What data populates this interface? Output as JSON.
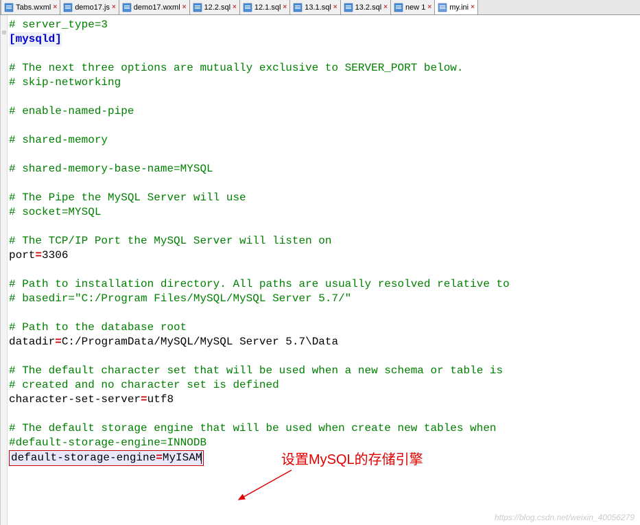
{
  "tabs": [
    {
      "label": "Tabs.wxml",
      "icon": "file-xml"
    },
    {
      "label": "demo17.js",
      "icon": "file-js"
    },
    {
      "label": "demo17.wxml",
      "icon": "file-xml"
    },
    {
      "label": "12.2.sql",
      "icon": "file-sql"
    },
    {
      "label": "12.1.sql",
      "icon": "file-sql"
    },
    {
      "label": "13.1.sql",
      "icon": "file-sql"
    },
    {
      "label": "13.2.sql",
      "icon": "file-sql"
    },
    {
      "label": "new 1",
      "icon": "file-txt"
    },
    {
      "label": "my.ini",
      "icon": "file-ini",
      "active": true
    }
  ],
  "code_lines": [
    {
      "type": "comment",
      "text": "# server_type=3"
    },
    {
      "type": "section",
      "text": "[mysqld]"
    },
    {
      "type": "blank",
      "text": ""
    },
    {
      "type": "comment",
      "text": "# The next three options are mutually exclusive to SERVER_PORT below."
    },
    {
      "type": "comment",
      "text": "# skip-networking"
    },
    {
      "type": "blank",
      "text": ""
    },
    {
      "type": "comment",
      "text": "# enable-named-pipe"
    },
    {
      "type": "blank",
      "text": ""
    },
    {
      "type": "comment",
      "text": "# shared-memory"
    },
    {
      "type": "blank",
      "text": ""
    },
    {
      "type": "comment",
      "text": "# shared-memory-base-name=MYSQL"
    },
    {
      "type": "blank",
      "text": ""
    },
    {
      "type": "comment",
      "text": "# The Pipe the MySQL Server will use"
    },
    {
      "type": "comment",
      "text": "# socket=MYSQL"
    },
    {
      "type": "blank",
      "text": ""
    },
    {
      "type": "comment",
      "text": "# The TCP/IP Port the MySQL Server will listen on"
    },
    {
      "type": "kv",
      "key": "port",
      "val": "3306"
    },
    {
      "type": "blank",
      "text": ""
    },
    {
      "type": "comment",
      "text": "# Path to installation directory. All paths are usually resolved relative to"
    },
    {
      "type": "comment",
      "text": "# basedir=\"C:/Program Files/MySQL/MySQL Server 5.7/\""
    },
    {
      "type": "blank",
      "text": ""
    },
    {
      "type": "comment",
      "text": "# Path to the database root"
    },
    {
      "type": "kv",
      "key": "datadir",
      "val": "C:/ProgramData/MySQL/MySQL Server 5.7\\Data"
    },
    {
      "type": "blank",
      "text": ""
    },
    {
      "type": "comment",
      "text": "# The default character set that will be used when a new schema or table is"
    },
    {
      "type": "comment",
      "text": "# created and no character set is defined"
    },
    {
      "type": "kv",
      "key": "character-set-server",
      "val": "utf8"
    },
    {
      "type": "blank",
      "text": ""
    },
    {
      "type": "comment",
      "text": "# The default storage engine that will be used when create new tables when"
    },
    {
      "type": "comment",
      "text": "#default-storage-engine=INNODB"
    },
    {
      "type": "kv-highlight",
      "key": "default-storage-engine",
      "val": "MyISAM"
    }
  ],
  "annotation": {
    "text": "设置MySQL的存储引擎"
  },
  "watermark": "https://blog.csdn.net/weixin_40056279"
}
